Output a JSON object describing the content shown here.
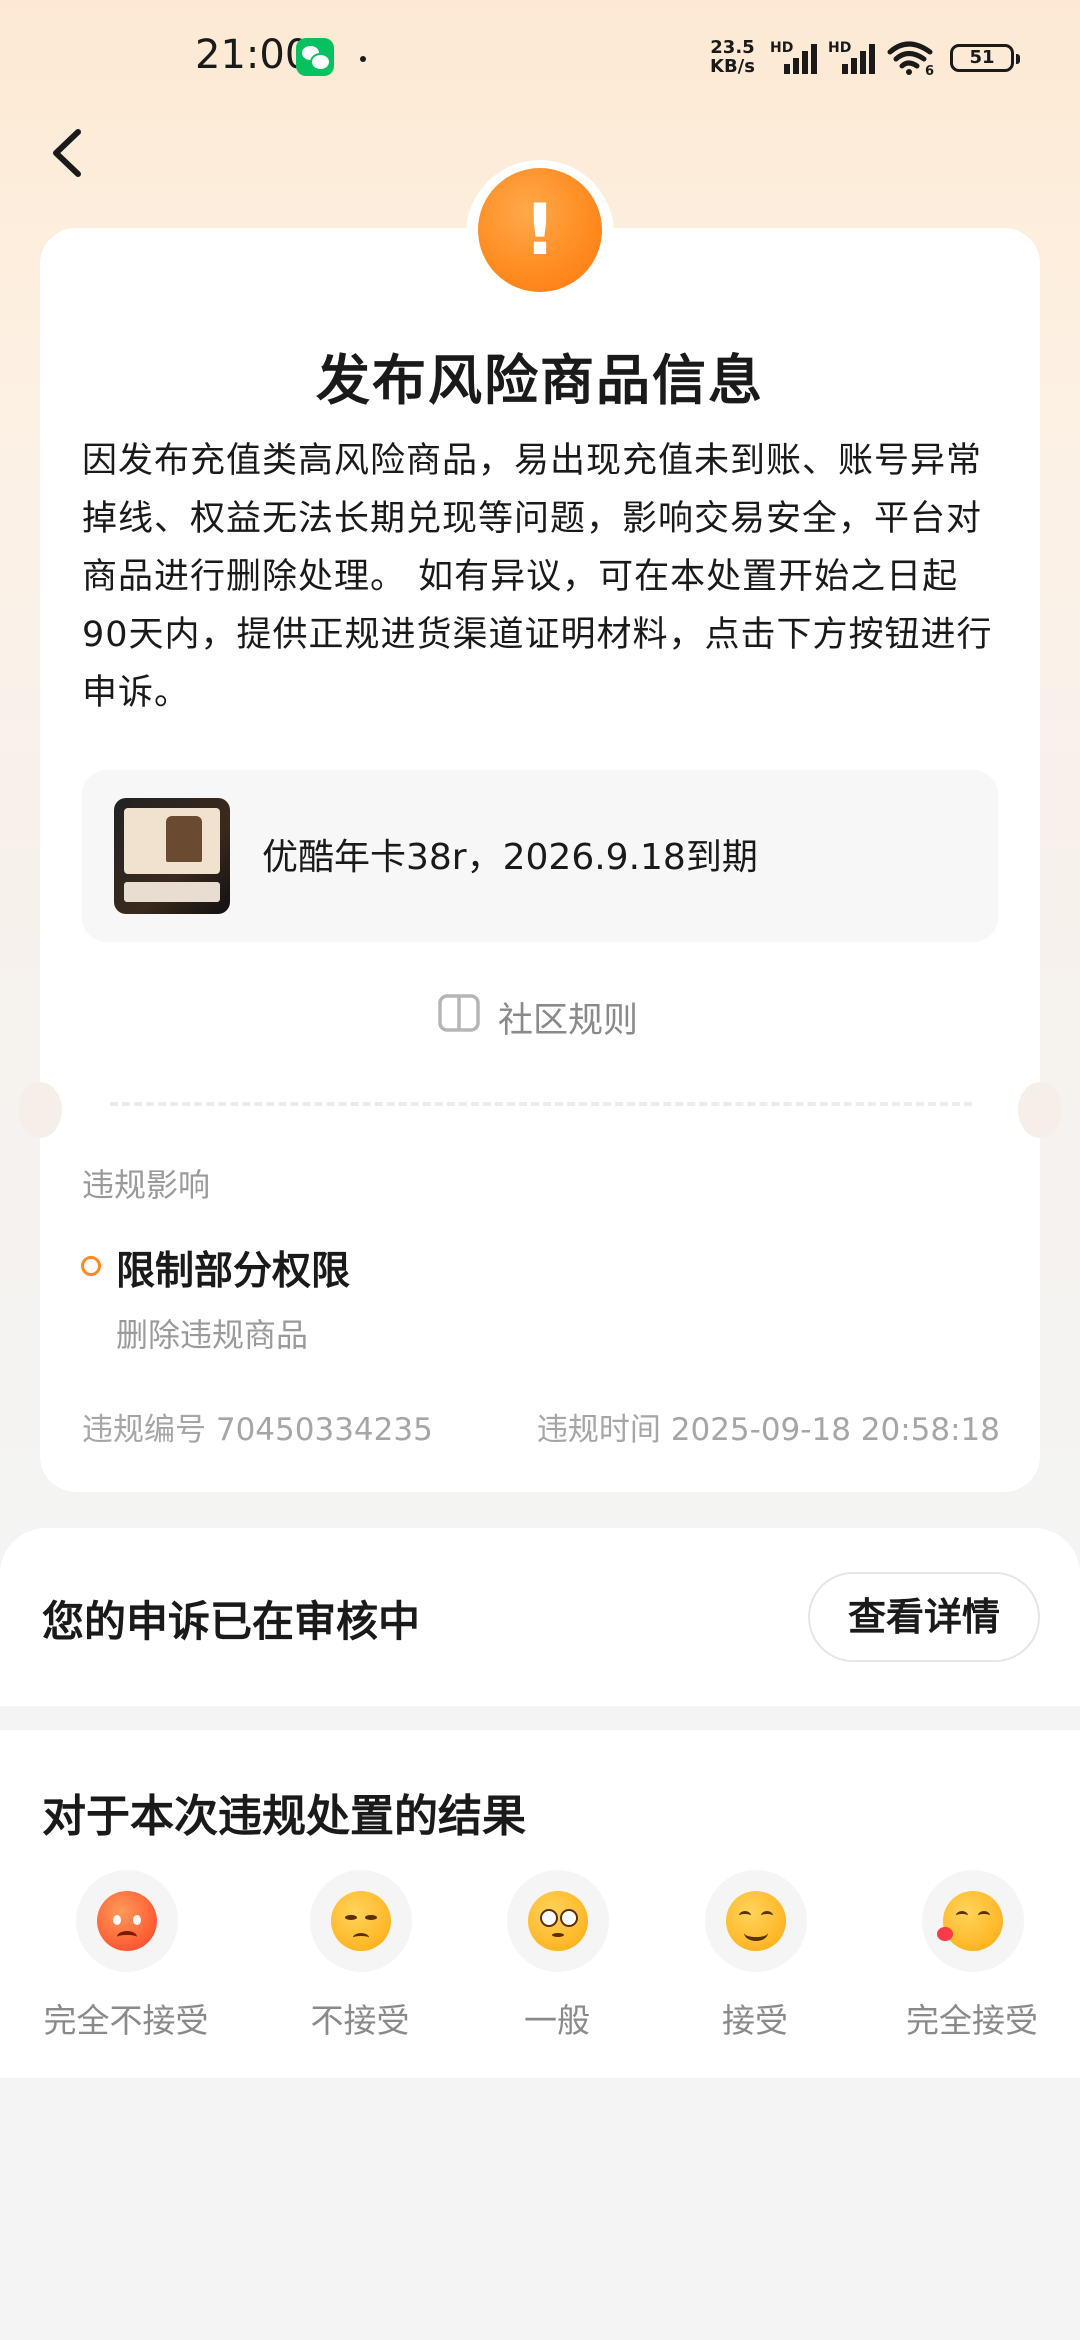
{
  "status_bar": {
    "time": "21:00",
    "net_speed_value": "23.5",
    "net_speed_unit": "KB/s",
    "signal_1_label": "HD",
    "signal_2_label": "HD",
    "wifi_label": "6",
    "battery": "51"
  },
  "card": {
    "title": "发布风险商品信息",
    "description": "因发布充值类高风险商品，易出现充值未到账、账号异常掉线、权益无法长期兑现等问题，影响交易安全，平台对商品进行删除处理。 如有异议，可在本处置开始之日起90天内，提供正规进货渠道证明材料，点击下方按钮进行申诉。",
    "product_name": "优酷年卡38r，2026.9.18到期",
    "rules_link": "社区规则",
    "impact_heading": "违规影响",
    "impact_title": "限制部分权限",
    "impact_detail": "删除违规商品",
    "violation_id": "违规编号 70450334235",
    "violation_time": "违规时间 2025-09-18 20:58:18"
  },
  "appeal": {
    "status_text": "您的申诉已在审核中",
    "details_button": "查看详情"
  },
  "feedback": {
    "title": "对于本次违规处置的结果",
    "options": [
      {
        "label": "完全不接受",
        "icon": "angry-face-icon"
      },
      {
        "label": "不接受",
        "icon": "unamused-face-icon"
      },
      {
        "label": "一般",
        "icon": "neutral-face-icon"
      },
      {
        "label": "接受",
        "icon": "smiling-face-icon"
      },
      {
        "label": "完全接受",
        "icon": "kissing-face-icon"
      }
    ]
  },
  "colors": {
    "accent_orange": "#ff8a1f",
    "header_gradient": "#fde9d3",
    "page_bg": "#f4f4f4"
  }
}
